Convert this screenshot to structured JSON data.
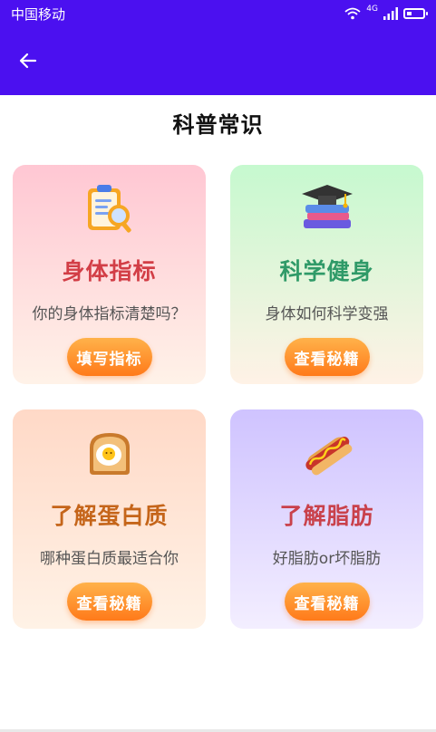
{
  "status_bar": {
    "carrier": "中国移动",
    "network": "4G"
  },
  "page": {
    "title": "科普常识"
  },
  "cards": [
    {
      "title": "身体指标",
      "desc": "你的身体指标清楚吗？",
      "button": "填写指标",
      "title_color": "#d23e46",
      "icon": "clipboard-icon"
    },
    {
      "title": "科学健身",
      "desc": "身体如何科学变强",
      "button": "查看秘籍",
      "title_color": "#2f9a68",
      "icon": "books-graduation-cap-icon"
    },
    {
      "title": "了解蛋白质",
      "desc": "哪种蛋白质最适合你",
      "button": "查看秘籍",
      "title_color": "#c5651a",
      "icon": "egg-toast-icon"
    },
    {
      "title": "了解脂肪",
      "desc": "好脂肪or坏脂肪",
      "button": "查看秘籍",
      "title_color": "#c9414b",
      "icon": "hotdog-icon"
    }
  ],
  "colors": {
    "app_bar": "#4b10f0",
    "button_gradient_top": "#ffb24a",
    "button_gradient_bottom": "#ff7a1a"
  }
}
